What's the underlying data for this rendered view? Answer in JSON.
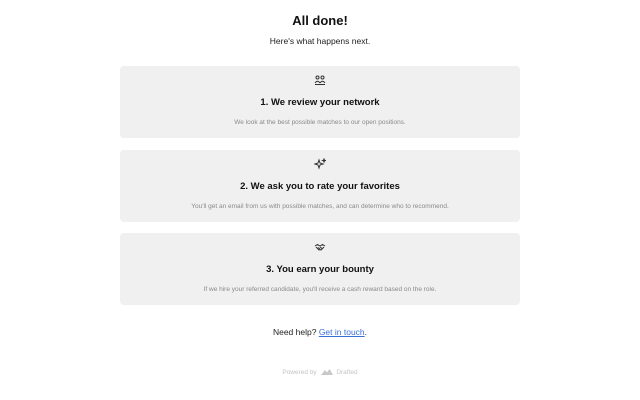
{
  "header": {
    "title": "All done!",
    "subtitle": "Here's what happens next."
  },
  "steps": [
    {
      "icon": "people-search-icon",
      "title": "1. We review your network",
      "description": "We look at the best possible matches to our open positions."
    },
    {
      "icon": "sparkles-icon",
      "title": "2. We ask you to rate your favorites",
      "description": "You'll get an email from us with possible matches, and can determine who to recommend."
    },
    {
      "icon": "handshake-icon",
      "title": "3. You earn your bounty",
      "description": "If we hire your referred candidate, you'll receive a cash reward based on the role."
    }
  ],
  "help": {
    "prefix": "Need help?",
    "link_label": "Get in touch",
    "suffix": "."
  },
  "footer": {
    "powered_by": "Powered by",
    "brand": "Drafted"
  },
  "colors": {
    "card_background": "#f0f0f0",
    "link": "#3b6fd8",
    "muted_text": "#8a8a8a"
  }
}
